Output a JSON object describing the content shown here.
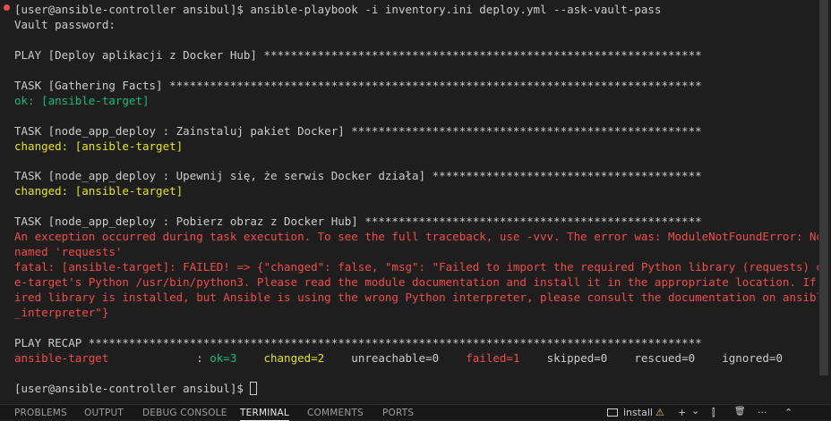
{
  "terminal": {
    "lines": [
      {
        "segments": [
          {
            "text": "[user@ansible-controller ansibul]$ ansible-playbook -i inventory.ini deploy.yml --ask-vault-pass",
            "cls": ""
          }
        ]
      },
      {
        "segments": [
          {
            "text": "Vault password:",
            "cls": ""
          }
        ]
      },
      {
        "segments": []
      },
      {
        "segments": [
          {
            "text": "PLAY [Deploy aplikacji z Docker Hub] *****************************************************************",
            "cls": ""
          }
        ]
      },
      {
        "segments": []
      },
      {
        "segments": [
          {
            "text": "TASK [Gathering Facts] *******************************************************************************",
            "cls": ""
          }
        ]
      },
      {
        "segments": [
          {
            "text": "ok: [ansible-target]",
            "cls": "ok"
          }
        ]
      },
      {
        "segments": []
      },
      {
        "segments": [
          {
            "text": "TASK [node_app_deploy : Zainstaluj pakiet Docker] ****************************************************",
            "cls": ""
          }
        ]
      },
      {
        "segments": [
          {
            "text": "changed: [ansible-target]",
            "cls": "yellow"
          }
        ]
      },
      {
        "segments": []
      },
      {
        "segments": [
          {
            "text": "TASK [node_app_deploy : Upewnij się, że serwis Docker działa] ****************************************",
            "cls": ""
          }
        ]
      },
      {
        "segments": [
          {
            "text": "changed: [ansible-target]",
            "cls": "yellow"
          }
        ]
      },
      {
        "segments": []
      },
      {
        "segments": [
          {
            "text": "TASK [node_app_deploy : Pobierz obraz z Docker Hub] **************************************************",
            "cls": ""
          }
        ]
      },
      {
        "segments": [
          {
            "text": "An exception occurred during task execution. To see the full traceback, use -vvv. The error was: ModuleNotFoundError: No module",
            "cls": "red"
          }
        ]
      },
      {
        "segments": [
          {
            "text": "named 'requests'",
            "cls": "red"
          }
        ]
      },
      {
        "segments": [
          {
            "text": "fatal: [ansible-target]: FAILED! => {\"changed\": false, \"msg\": \"Failed to import the required Python library (requests) on ansibl",
            "cls": "red"
          }
        ]
      },
      {
        "segments": [
          {
            "text": "e-target's Python /usr/bin/python3. Please read the module documentation and install it in the appropriate location. If the requ",
            "cls": "red"
          }
        ]
      },
      {
        "segments": [
          {
            "text": "ired library is installed, but Ansible is using the wrong Python interpreter, please consult the documentation on ansible_python",
            "cls": "red"
          }
        ]
      },
      {
        "segments": [
          {
            "text": "_interpreter\"}",
            "cls": "red"
          }
        ]
      },
      {
        "segments": []
      },
      {
        "segments": [
          {
            "text": "PLAY RECAP *******************************************************************************************",
            "cls": ""
          }
        ]
      },
      {
        "segments": [
          {
            "text": "ansible-target",
            "cls": "red"
          },
          {
            "text": "             : ",
            "cls": ""
          },
          {
            "text": "ok=3",
            "cls": "ok"
          },
          {
            "text": "    ",
            "cls": ""
          },
          {
            "text": "changed=2",
            "cls": "yellow"
          },
          {
            "text": "    unreachable=0    ",
            "cls": ""
          },
          {
            "text": "failed=1",
            "cls": "red"
          },
          {
            "text": "    skipped=0    rescued=0    ignored=0",
            "cls": ""
          }
        ]
      },
      {
        "segments": []
      },
      {
        "segments": [
          {
            "text": "[user@ansible-controller ansibul]$ ",
            "cls": ""
          }
        ],
        "cursor": true
      }
    ]
  },
  "panel": {
    "tabs": [
      {
        "label": "PROBLEMS",
        "name": "tab-problems",
        "active": false
      },
      {
        "label": "OUTPUT",
        "name": "tab-output",
        "active": false
      },
      {
        "label": "DEBUG CONSOLE",
        "name": "tab-debug-console",
        "active": false
      },
      {
        "label": "TERMINAL",
        "name": "tab-terminal",
        "active": true
      },
      {
        "label": "COMMENTS",
        "name": "tab-comments",
        "active": false
      },
      {
        "label": "PORTS",
        "name": "tab-ports",
        "active": false
      }
    ],
    "terminal_name": "install",
    "warning_glyph": "⚠",
    "add_glyph": "+",
    "dropdown_glyph": "⌄",
    "split_glyph": "⫿",
    "trash_glyph": "🗑",
    "more_glyph": "···",
    "chevron_glyph": "⌃"
  }
}
